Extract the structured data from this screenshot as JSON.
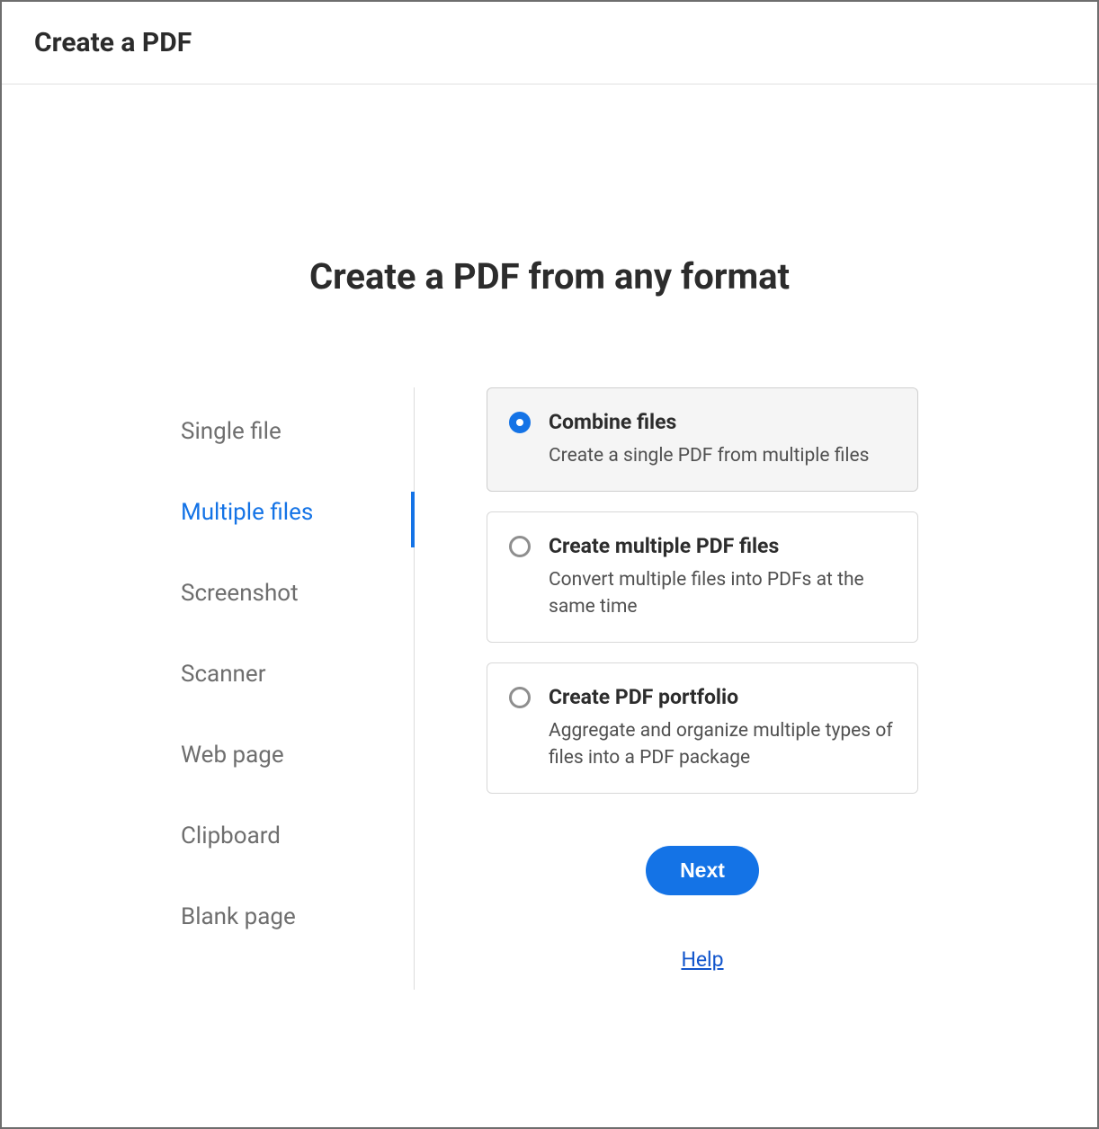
{
  "header": {
    "title": "Create a PDF"
  },
  "main": {
    "heading": "Create a PDF from any format"
  },
  "sidebar": {
    "items": [
      {
        "label": "Single file",
        "active": false
      },
      {
        "label": "Multiple files",
        "active": true
      },
      {
        "label": "Screenshot",
        "active": false
      },
      {
        "label": "Scanner",
        "active": false
      },
      {
        "label": "Web page",
        "active": false
      },
      {
        "label": "Clipboard",
        "active": false
      },
      {
        "label": "Blank page",
        "active": false
      }
    ]
  },
  "options": [
    {
      "title": "Combine files",
      "description": "Create a single PDF from multiple files",
      "selected": true
    },
    {
      "title": "Create multiple PDF files",
      "description": "Convert multiple files into PDFs at the same time",
      "selected": false
    },
    {
      "title": "Create PDF portfolio",
      "description": "Aggregate and organize multiple types of files into a PDF package",
      "selected": false
    }
  ],
  "buttons": {
    "next": "Next",
    "help": "Help"
  }
}
